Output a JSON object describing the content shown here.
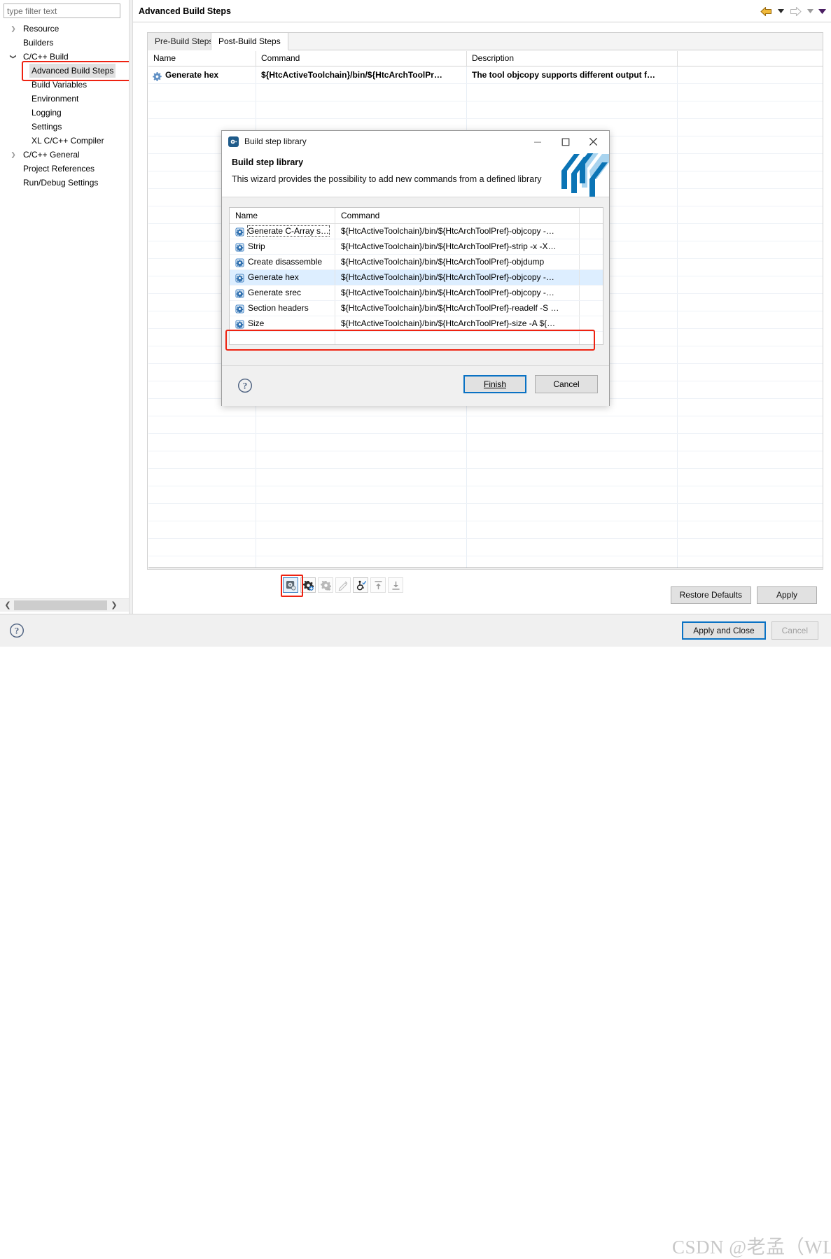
{
  "sidebar": {
    "filter": {
      "placeholder": "type filter text",
      "value": ""
    },
    "items": [
      {
        "label": "Resource",
        "indent": 30,
        "twisty": "collapsed",
        "selected": false
      },
      {
        "label": "Builders",
        "indent": 30,
        "twisty": "none",
        "selected": false
      },
      {
        "label": "C/C++ Build",
        "indent": 30,
        "twisty": "expanded",
        "selected": false
      },
      {
        "label": "Advanced Build Steps",
        "indent": 42,
        "twisty": "none",
        "selected": true
      },
      {
        "label": "Build Variables",
        "indent": 42,
        "twisty": "none",
        "selected": false
      },
      {
        "label": "Environment",
        "indent": 42,
        "twisty": "none",
        "selected": false
      },
      {
        "label": "Logging",
        "indent": 42,
        "twisty": "none",
        "selected": false
      },
      {
        "label": "Settings",
        "indent": 42,
        "twisty": "none",
        "selected": false
      },
      {
        "label": "XL C/C++ Compiler",
        "indent": 42,
        "twisty": "none",
        "selected": false
      },
      {
        "label": "C/C++ General",
        "indent": 30,
        "twisty": "collapsed",
        "selected": false
      },
      {
        "label": "Project References",
        "indent": 30,
        "twisty": "none",
        "selected": false
      },
      {
        "label": "Run/Debug Settings",
        "indent": 30,
        "twisty": "none",
        "selected": false
      }
    ]
  },
  "header": {
    "title": "Advanced Build Steps",
    "nav": {
      "back_icon": "back-arrow-icon",
      "back_menu_icon": "chevron-down-icon",
      "forward_icon": "forward-arrow-icon",
      "forward_menu_icon": "chevron-down-icon",
      "more_menu_icon": "chevron-down-icon"
    }
  },
  "main": {
    "tabs": [
      {
        "label": "Pre-Build Steps",
        "active": false
      },
      {
        "label": "Post-Build Steps",
        "active": true
      }
    ],
    "table": {
      "columns": [
        "Name",
        "Command",
        "Description",
        ""
      ],
      "rows": [
        {
          "icon": "gear-icon",
          "name": "Generate hex",
          "command": "${HtcActiveToolchain}/bin/${HtcArchToolPr…",
          "description": "The tool objcopy supports different output f…",
          "extra": ""
        }
      ],
      "empty_row_count": 29
    },
    "toolbar": [
      {
        "name": "add-from-library-button",
        "icon": "library-add-icon",
        "state": "selected"
      },
      {
        "name": "add-step-button",
        "icon": "gear-plus-icon",
        "state": "enabled"
      },
      {
        "name": "remove-step-button",
        "icon": "gear-minus-icon",
        "state": "disabled"
      },
      {
        "name": "edit-step-button",
        "icon": "pencil-icon",
        "state": "disabled"
      },
      {
        "name": "toggle-enable-button",
        "icon": "accessibility-check-icon",
        "state": "enabled"
      },
      {
        "name": "move-up-button",
        "icon": "arrow-up-bar-icon",
        "state": "disabled"
      },
      {
        "name": "move-down-button",
        "icon": "arrow-down-bar-icon",
        "state": "disabled"
      }
    ],
    "buttons": {
      "restore_defaults": "Restore Defaults",
      "apply": "Apply"
    }
  },
  "bottom": {
    "help_icon": "help-question-icon",
    "apply_and_close": "Apply and Close",
    "cancel": "Cancel",
    "watermark": "CSDN @老孟（WLY）"
  },
  "dialog": {
    "window_title": "Build step library",
    "app_icon": "build-step-library-icon",
    "window_buttons": {
      "minimize": "minimize-icon",
      "maximize": "maximize-icon",
      "close": "close-icon"
    },
    "heading": "Build step library",
    "subheading": "This wizard provides the possibility to add new commands from a defined library",
    "logo": "hightec-logo",
    "table": {
      "columns": [
        "Name",
        "Command",
        ""
      ],
      "rows": [
        {
          "icon": "step-icon",
          "name": "Generate C-Array s…",
          "command": "${HtcActiveToolchain}/bin/${HtcArchToolPref}-objcopy -…",
          "selected": false,
          "focused": true
        },
        {
          "icon": "step-icon",
          "name": "Strip",
          "command": "${HtcActiveToolchain}/bin/${HtcArchToolPref}-strip -x -X…",
          "selected": false,
          "focused": false
        },
        {
          "icon": "step-icon",
          "name": "Create disassemble",
          "command": "${HtcActiveToolchain}/bin/${HtcArchToolPref}-objdump",
          "selected": false,
          "focused": false
        },
        {
          "icon": "step-icon",
          "name": "Generate hex",
          "command": "${HtcActiveToolchain}/bin/${HtcArchToolPref}-objcopy -…",
          "selected": true,
          "focused": false
        },
        {
          "icon": "step-icon",
          "name": "Generate srec",
          "command": "${HtcActiveToolchain}/bin/${HtcArchToolPref}-objcopy -…",
          "selected": false,
          "focused": false
        },
        {
          "icon": "step-icon",
          "name": "Section headers",
          "command": "${HtcActiveToolchain}/bin/${HtcArchToolPref}-readelf -S …",
          "selected": false,
          "focused": false
        },
        {
          "icon": "step-icon",
          "name": "Size",
          "command": "${HtcActiveToolchain}/bin/${HtcArchToolPref}-size -A ${…",
          "selected": false,
          "focused": false
        }
      ]
    },
    "help_icon": "help-question-icon",
    "buttons": {
      "finish": "Finish",
      "cancel": "Cancel"
    }
  },
  "colors": {
    "highlight_red": "#ee2211",
    "selection_blue": "#ddeeff",
    "focus_border_blue": "#0a72c4",
    "logo_blue": "#0b74b5",
    "icon_blue": "#3b7fc4"
  }
}
